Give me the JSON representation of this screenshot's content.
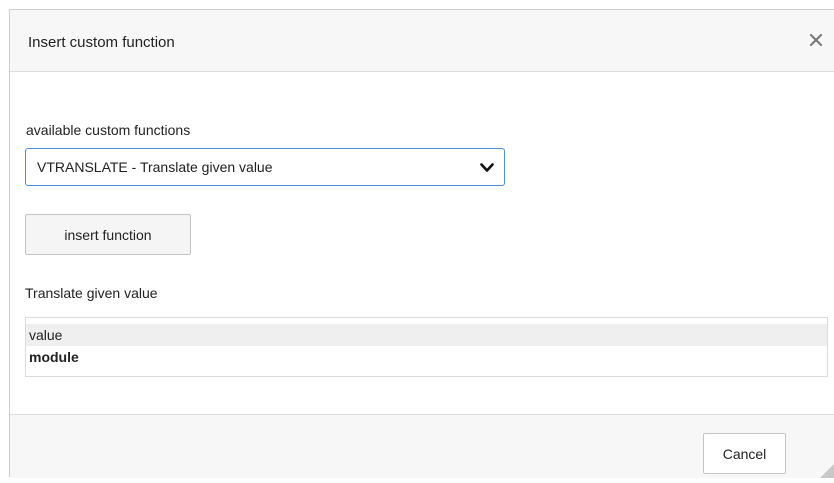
{
  "dialog": {
    "title": "Insert custom function",
    "close_icon": "close-icon"
  },
  "form": {
    "select_label": "available custom functions",
    "selected_function": "VTRANSLATE - Translate given value",
    "select_icon": "chevron-down-icon",
    "insert_button_label": "insert function",
    "description": "Translate given value",
    "parameters": [
      {
        "name": "value",
        "required": false
      },
      {
        "name": "module",
        "required": true
      }
    ]
  },
  "footer": {
    "cancel_label": "Cancel",
    "resize_icon": "resize-grip-icon"
  },
  "colors": {
    "select_border": "#4a90d9",
    "titlebar_bg": "#f7f7f7",
    "row_highlight": "#efefef"
  }
}
